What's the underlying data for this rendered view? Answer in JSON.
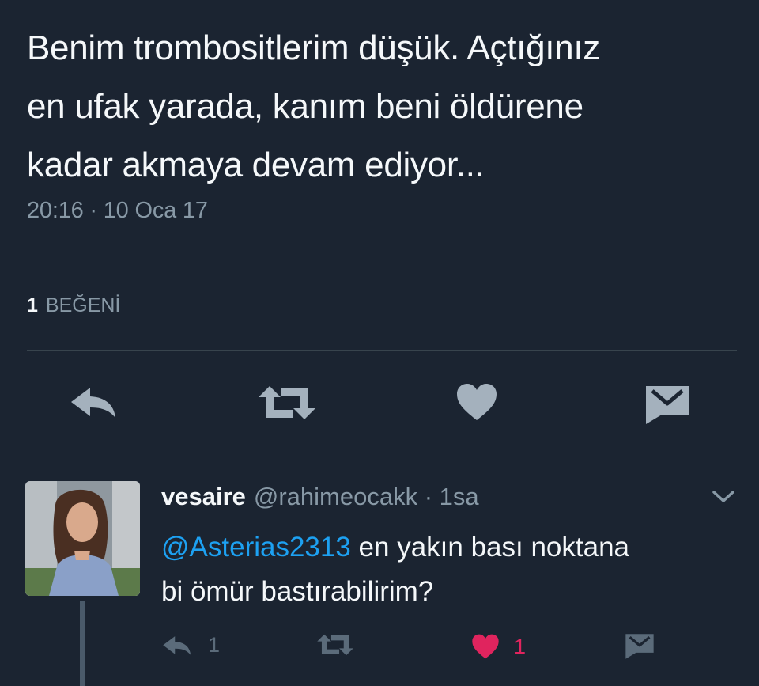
{
  "tweet": {
    "lines": [
      "Benim trombositlerim düşük. Açtığınız",
      "en ufak yarada, kanım beni öldürene",
      "kadar akmaya devam ediyor..."
    ],
    "time": "20:16 · 10 Oca 17",
    "likes_count": "1",
    "likes_label": "BEĞENİ"
  },
  "actions": {
    "icons": [
      "reply-icon",
      "retweet-icon",
      "heart-icon",
      "message-icon"
    ]
  },
  "reply": {
    "display_name": "vesaire",
    "handle": "@rahimeocakk",
    "time": "· 1sa",
    "mention": "@Asterias2313",
    "text_line1": " en yakın bası noktana",
    "text_line2": "bi ömür bastırabilirim?",
    "reply_count": "1",
    "like_count": "1",
    "colors": {
      "like": "#e0245e",
      "mention": "#1da1f2"
    }
  }
}
